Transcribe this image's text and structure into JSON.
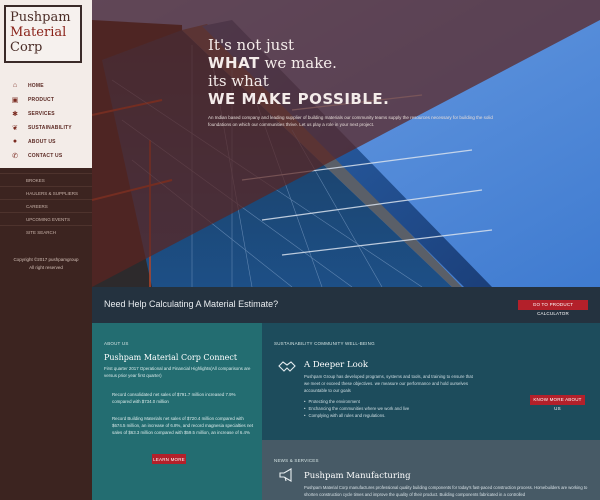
{
  "logo": {
    "line1": "Pushpam",
    "line2": "Material",
    "line3": "Corp"
  },
  "nav": [
    {
      "label": "HOME",
      "icon": "home-icon",
      "glyph": "⌂"
    },
    {
      "label": "PRODUCT",
      "icon": "cart-icon",
      "glyph": "▣"
    },
    {
      "label": "SERVICES",
      "icon": "gear-icon",
      "glyph": "✱"
    },
    {
      "label": "SUSTAINABILITY",
      "icon": "leaf-icon",
      "glyph": "❦"
    },
    {
      "label": "ABOUT US",
      "icon": "info-icon",
      "glyph": "●"
    },
    {
      "label": "CONTACT US",
      "icon": "phone-icon",
      "glyph": "✆"
    }
  ],
  "subnav": [
    "BROKES",
    "HAULERS & SUPPLIERS",
    "CAREERS",
    "UPCOMING EVENTS",
    "SITE SEARCH"
  ],
  "copyright": {
    "line1": "Copyright ©2017 pushpamgroup",
    "line2": "All right reserved"
  },
  "hero": {
    "line1": "It's not just",
    "line2_strong": "WHAT",
    "line2_rest": " we make.",
    "line3": "its what",
    "line4": "WE MAKE POSSIBLE.",
    "subtext": "An Indian based company and leading supplier of building materials our community teams supply the resources necessary for building the solid foundations on which our communities thrive. Let us play a role in your next project."
  },
  "banner": {
    "title": "Need Help Calculating A Material Estimate?",
    "button": "GO TO PRODUCT CALCULATOR"
  },
  "about": {
    "label": "ABOUT US",
    "title": "Pushpam Material Corp Connect",
    "intro": "First quarter 2017 Operational and Financial Highlights(All comparisons are versus prior year first quarter)",
    "p1": "Record consolidated net sales of $791.7 million increased 7.9% compared with $734.0 million",
    "p2": "Record Building Materials net sales of $720.4 million compared with $674.5 million, an increase of 6.8%, and record magnesia specialties net sales of $63.3 million compared with $59.5 million, an increase of 6.4%",
    "button": "LEARN MORE"
  },
  "sustain": {
    "label": "SUSTAINABILITY COMMUNITY WELL-BEING",
    "title": "A Deeper Look",
    "text": "Pushpam Group has developed programs, systems and tools, and training to ensure that we meet or exceed these objectives. we measure our performance and hold ourselves accountable to our goals",
    "items": [
      "Protecting the environment",
      "Enchancing the communities where we work and live",
      "Complying with all rules and regulations."
    ],
    "button": "KNOW MORE ABOUT US"
  },
  "news": {
    "label": "NEWS & SERVICES",
    "title": "Pushpam Manufacturing",
    "text": "Pushpam Material Corp manufactures professional quality building components for today's fast-paced construction process. Homebuilders are working to shorten construction cycle times and improve the quality of their product. Building components fabricated in a controlled"
  }
}
